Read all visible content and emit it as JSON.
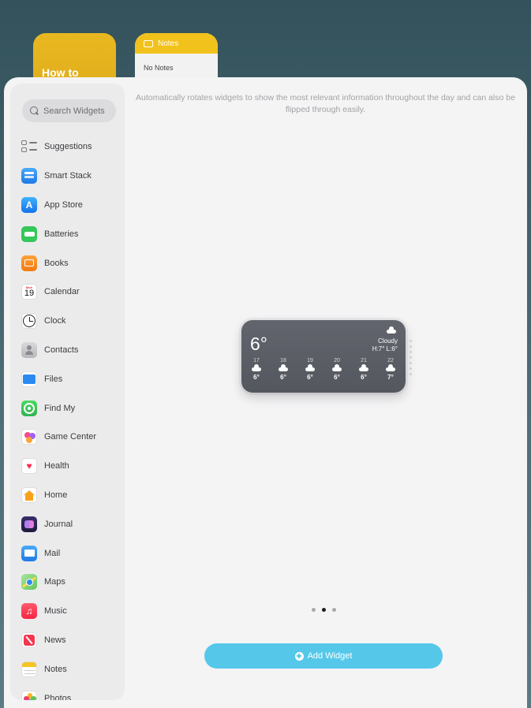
{
  "background": {
    "widget1_text": "How to",
    "notes_widget": {
      "title": "Notes",
      "body": "No Notes"
    }
  },
  "search": {
    "placeholder": "Search Widgets"
  },
  "sidebar": {
    "items": [
      {
        "label": "Suggestions",
        "icon": "suggestions-icon"
      },
      {
        "label": "Smart Stack",
        "icon": "smart-stack-icon",
        "color": "#2f8ff0"
      },
      {
        "label": "App Store",
        "icon": "app-store-icon",
        "color": "#1a8cf5"
      },
      {
        "label": "Batteries",
        "icon": "batteries-icon",
        "color": "#34c759"
      },
      {
        "label": "Books",
        "icon": "books-icon",
        "color": "#f5891f"
      },
      {
        "label": "Calendar",
        "icon": "calendar-icon",
        "color": "#ffffff",
        "glyph_top": "Mon",
        "glyph": "19"
      },
      {
        "label": "Clock",
        "icon": "clock-icon",
        "color": "#ffffff"
      },
      {
        "label": "Contacts",
        "icon": "contacts-icon",
        "color": "#c9c9cc"
      },
      {
        "label": "Files",
        "icon": "files-icon",
        "color": "#2b8af2"
      },
      {
        "label": "Find My",
        "icon": "find-my-icon",
        "color": "#34c759"
      },
      {
        "label": "Game Center",
        "icon": "game-center-icon",
        "color": "#ffffff"
      },
      {
        "label": "Health",
        "icon": "health-icon",
        "color": "#ffffff"
      },
      {
        "label": "Home",
        "icon": "home-icon",
        "color": "#ffffff"
      },
      {
        "label": "Journal",
        "icon": "journal-icon",
        "color": "#2d2350"
      },
      {
        "label": "Mail",
        "icon": "mail-icon",
        "color": "#2b8af2"
      },
      {
        "label": "Maps",
        "icon": "maps-icon",
        "color": "#7fd36b"
      },
      {
        "label": "Music",
        "icon": "music-icon",
        "color": "#fa3e56"
      },
      {
        "label": "News",
        "icon": "news-icon",
        "color": "#ffffff"
      },
      {
        "label": "Notes",
        "icon": "notes-icon",
        "color": "#ffffff"
      },
      {
        "label": "Photos",
        "icon": "photos-icon",
        "color": "#ffffff"
      }
    ]
  },
  "main": {
    "description": "Automatically rotates widgets to show the most relevant information throughout the day and can also be flipped through easily.",
    "weather": {
      "temp": "6°",
      "condition": "Cloudy",
      "hilo": "H:7° L:6°",
      "hours": [
        {
          "hour": "17",
          "temp": "6°"
        },
        {
          "hour": "18",
          "temp": "6°"
        },
        {
          "hour": "19",
          "temp": "6°"
        },
        {
          "hour": "20",
          "temp": "6°"
        },
        {
          "hour": "21",
          "temp": "6°"
        },
        {
          "hour": "22",
          "temp": "7°"
        }
      ]
    },
    "page_indicator": {
      "count": 3,
      "active": 2
    },
    "add_button": "Add Widget"
  }
}
